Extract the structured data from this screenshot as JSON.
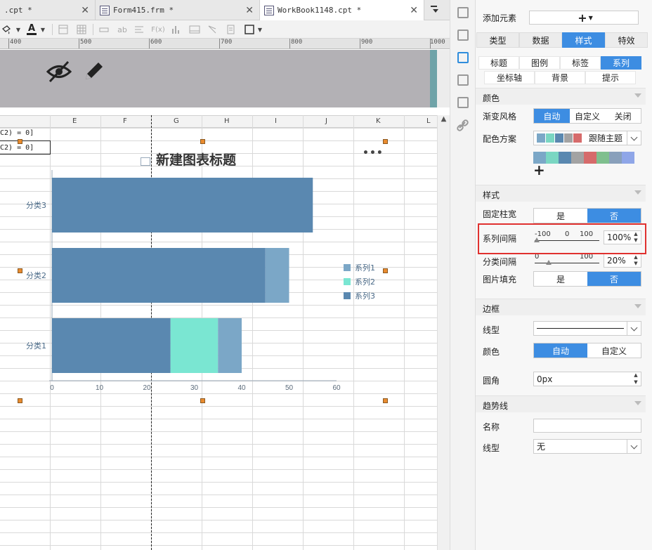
{
  "tabs": [
    {
      "title": ".cpt *",
      "active": false
    },
    {
      "title": "Form415.frm *",
      "active": false
    },
    {
      "title": "WorkBook1148.cpt *",
      "active": true
    }
  ],
  "ruler": [
    "400",
    "500",
    "600",
    "700",
    "800",
    "900",
    "1000"
  ],
  "columns": [
    "E",
    "F",
    "G",
    "H",
    "I",
    "J",
    "K",
    "L"
  ],
  "cells": [
    "C2) = 0]",
    "C2) = 0]"
  ],
  "chart": {
    "title": "新建图表标题",
    "more": "•••"
  },
  "chart_data": {
    "type": "bar",
    "orientation": "horizontal",
    "stacked": true,
    "title": "新建图表标题",
    "categories": [
      "分类1",
      "分类2",
      "分类3"
    ],
    "x_ticks": [
      "0",
      "10",
      "20",
      "30",
      "40",
      "50",
      "60"
    ],
    "xlim": [
      0,
      60
    ],
    "series": [
      {
        "name": "系列1",
        "color": "#7ba7c7",
        "values": [
          5,
          5,
          0
        ]
      },
      {
        "name": "系列2",
        "color": "#7ae6d2",
        "values": [
          10,
          0,
          0
        ]
      },
      {
        "name": "系列3",
        "color": "#5a88b0",
        "values": [
          25,
          45,
          55
        ]
      }
    ],
    "legend_position": "right"
  },
  "panel": {
    "add_element_label": "添加元素",
    "add_element_btn": "+",
    "main_tabs": [
      {
        "label": "类型",
        "on": false
      },
      {
        "label": "数据",
        "on": false
      },
      {
        "label": "样式",
        "on": true
      },
      {
        "label": "特效",
        "on": false
      }
    ],
    "sub_tabs_row1": [
      {
        "label": "标题",
        "on": false
      },
      {
        "label": "图例",
        "on": false
      },
      {
        "label": "标签",
        "on": false
      },
      {
        "label": "系列",
        "on": true
      }
    ],
    "sub_tabs_row2": [
      {
        "label": "坐标轴",
        "on": false
      },
      {
        "label": "背景",
        "on": false
      },
      {
        "label": "提示",
        "on": false
      }
    ],
    "color_section": "颜色",
    "gradient_label": "渐变风格",
    "gradient_opts": [
      {
        "label": "自动",
        "on": true
      },
      {
        "label": "自定义",
        "on": false
      },
      {
        "label": "关闭",
        "on": false
      }
    ],
    "scheme_label": "配色方案",
    "scheme_value": "跟随主题",
    "scheme_colors": [
      "#7ba7c7",
      "#7ad6c2",
      "#5a88b0",
      "#a3a3a3",
      "#d66b6b"
    ],
    "palette": [
      "#7ba7c7",
      "#7ad6c2",
      "#5a88b0",
      "#a3a3a3",
      "#d66b6b",
      "#7fbf8e",
      "#89a0bb",
      "#8fa6e8"
    ],
    "palette_add": "+",
    "style_section": "样式",
    "fixed_width_label": "固定柱宽",
    "fixed_width_opts": [
      {
        "label": "是",
        "on": false
      },
      {
        "label": "否",
        "on": true
      }
    ],
    "series_gap_label": "系列间隔",
    "series_gap_ticks": [
      "-100",
      "0",
      "100"
    ],
    "series_gap_value": "100%",
    "category_gap_label": "分类间隔",
    "category_gap_ticks": [
      "0",
      "100"
    ],
    "category_gap_value": "20%",
    "image_fill_label": "图片填充",
    "image_fill_opts": [
      {
        "label": "是",
        "on": false
      },
      {
        "label": "否",
        "on": true
      }
    ],
    "border_section": "边框",
    "line_type_label": "线型",
    "border_color_label": "颜色",
    "border_color_opts": [
      {
        "label": "自动",
        "on": true
      },
      {
        "label": "自定义",
        "on": false
      }
    ],
    "radius_label": "圆角",
    "radius_value": "0px",
    "trend_section": "趋势线",
    "trend_name_label": "名称",
    "trend_name_value": "",
    "trend_line_label": "线型",
    "trend_line_value": "无"
  }
}
